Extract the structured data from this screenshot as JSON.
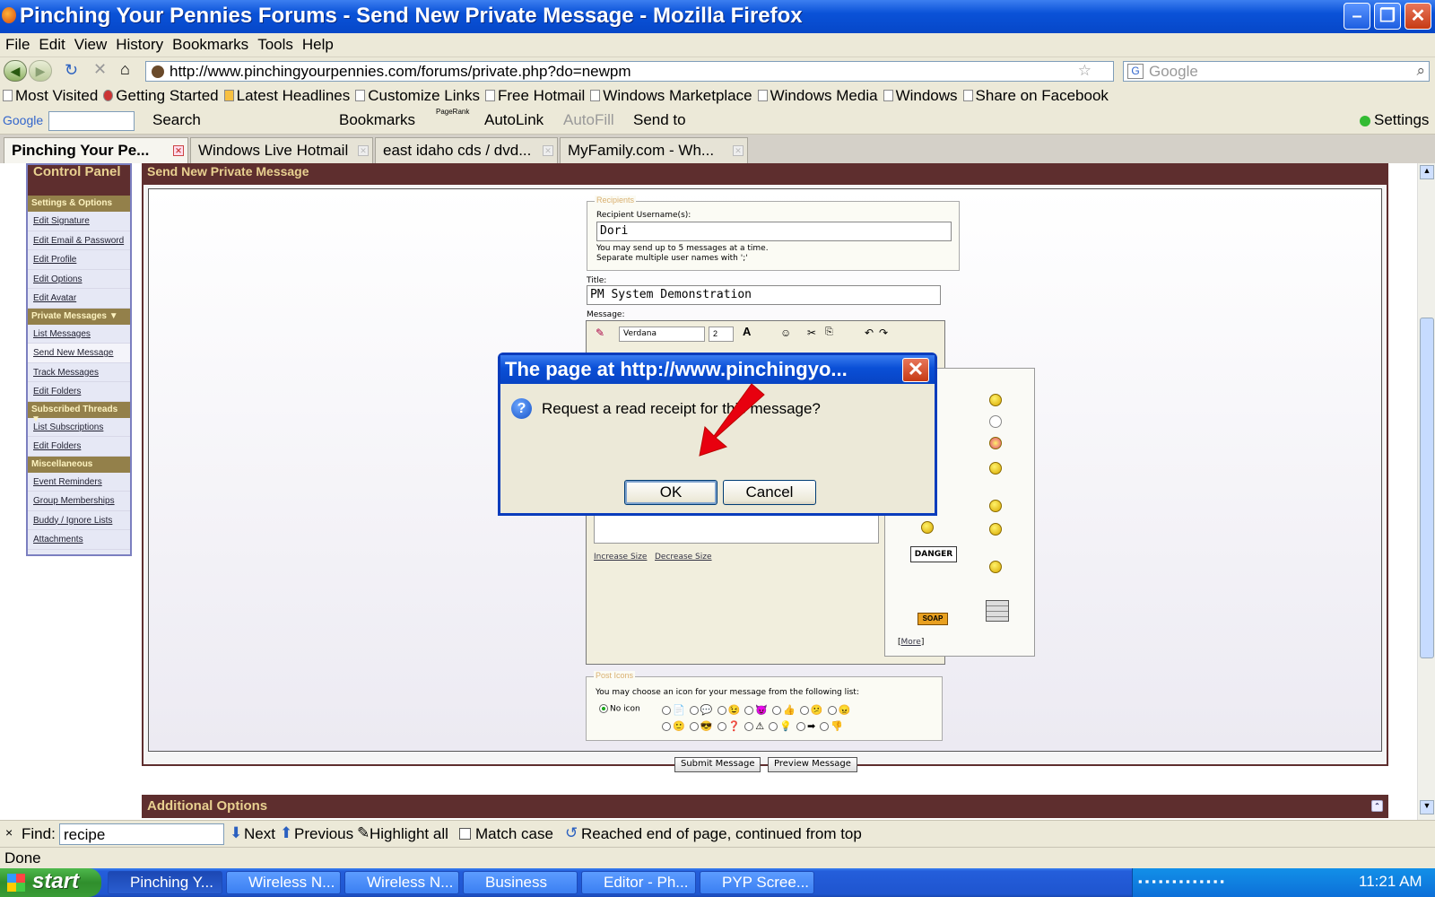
{
  "window": {
    "title": "Pinching Your Pennies Forums - Send New Private Message - Mozilla Firefox"
  },
  "menu": [
    "File",
    "Edit",
    "View",
    "History",
    "Bookmarks",
    "Tools",
    "Help"
  ],
  "nav": {
    "url": "http://www.pinchingyourpennies.com/forums/private.php?do=newpm",
    "search_placeholder": "Google"
  },
  "bookmarks": [
    "Most Visited",
    "Getting Started",
    "Latest Headlines",
    "Customize Links",
    "Free Hotmail",
    "Windows Marketplace",
    "Windows Media",
    "Windows",
    "Share on Facebook"
  ],
  "google_toolbar": {
    "logo": "Google",
    "search": "Search",
    "bookmarks": "Bookmarks",
    "pagerank": "PageRank",
    "autolink": "AutoLink",
    "autofill": "AutoFill",
    "sendto": "Send to",
    "settings": "Settings"
  },
  "tabs": [
    "Pinching Your Pe...",
    "Windows Live Hotmail",
    "east idaho cds / dvd...",
    "MyFamily.com - Wh..."
  ],
  "sidebar": {
    "title": "Control Panel",
    "sections": [
      {
        "heading": "Settings & Options",
        "links": [
          "Edit Signature",
          "Edit Email & Password",
          "Edit Profile",
          "Edit Options",
          "Edit Avatar"
        ]
      },
      {
        "heading": "Private Messages",
        "links": [
          "List Messages",
          "Send New Message",
          "Track Messages",
          "Edit Folders"
        ]
      },
      {
        "heading": "Subscribed Threads",
        "links": [
          "List Subscriptions",
          "Edit Folders"
        ]
      },
      {
        "heading": "Miscellaneous",
        "links": [
          "Event Reminders",
          "Group Memberships",
          "Buddy / Ignore Lists",
          "Attachments"
        ]
      }
    ]
  },
  "main": {
    "heading": "Send New Private Message",
    "recipients_legend": "Recipients",
    "recipient_label": "Recipient Username(s):",
    "recipient_value": "Dori",
    "recipient_hint1": "You may send up to 5 messages at a time.",
    "recipient_hint2": "Separate multiple user names with ';'",
    "title_label": "Title:",
    "title_value": "PM System Demonstration",
    "message_label": "Message:",
    "font_value": "Verdana",
    "size_value": "2",
    "increase_size": "Increase Size",
    "decrease_size": "Decrease Size",
    "danger_sign": "DANGER",
    "soap_sign": "SOAP",
    "more_link": "More",
    "post_icons_legend": "Post Icons",
    "post_icons_hint": "You may choose an icon for your message from the following list:",
    "no_icon": "No icon",
    "submit": "Submit Message",
    "preview": "Preview Message",
    "additional": "Additional Options"
  },
  "dialog": {
    "title": "The page at http://www.pinchingyo...",
    "message": "Request a read receipt for this message?",
    "ok": "OK",
    "cancel": "Cancel"
  },
  "findbar": {
    "label": "Find:",
    "value": "recipe",
    "next": "Next",
    "previous": "Previous",
    "highlight": "Highlight all",
    "matchcase": "Match case",
    "status": "Reached end of page, continued from top"
  },
  "status": "Done",
  "taskbar": {
    "start": "start",
    "items": [
      "Pinching Y...",
      "Wireless N...",
      "Wireless N...",
      "Business",
      "Editor - Ph...",
      "PYP Scree..."
    ],
    "clock": "11:21 AM"
  },
  "colors": {
    "forum_header": "#5e2e2e",
    "forum_subheader": "#93804a",
    "xp_blue": "#0a52d8",
    "annotation_arrow": "#e8000f"
  }
}
